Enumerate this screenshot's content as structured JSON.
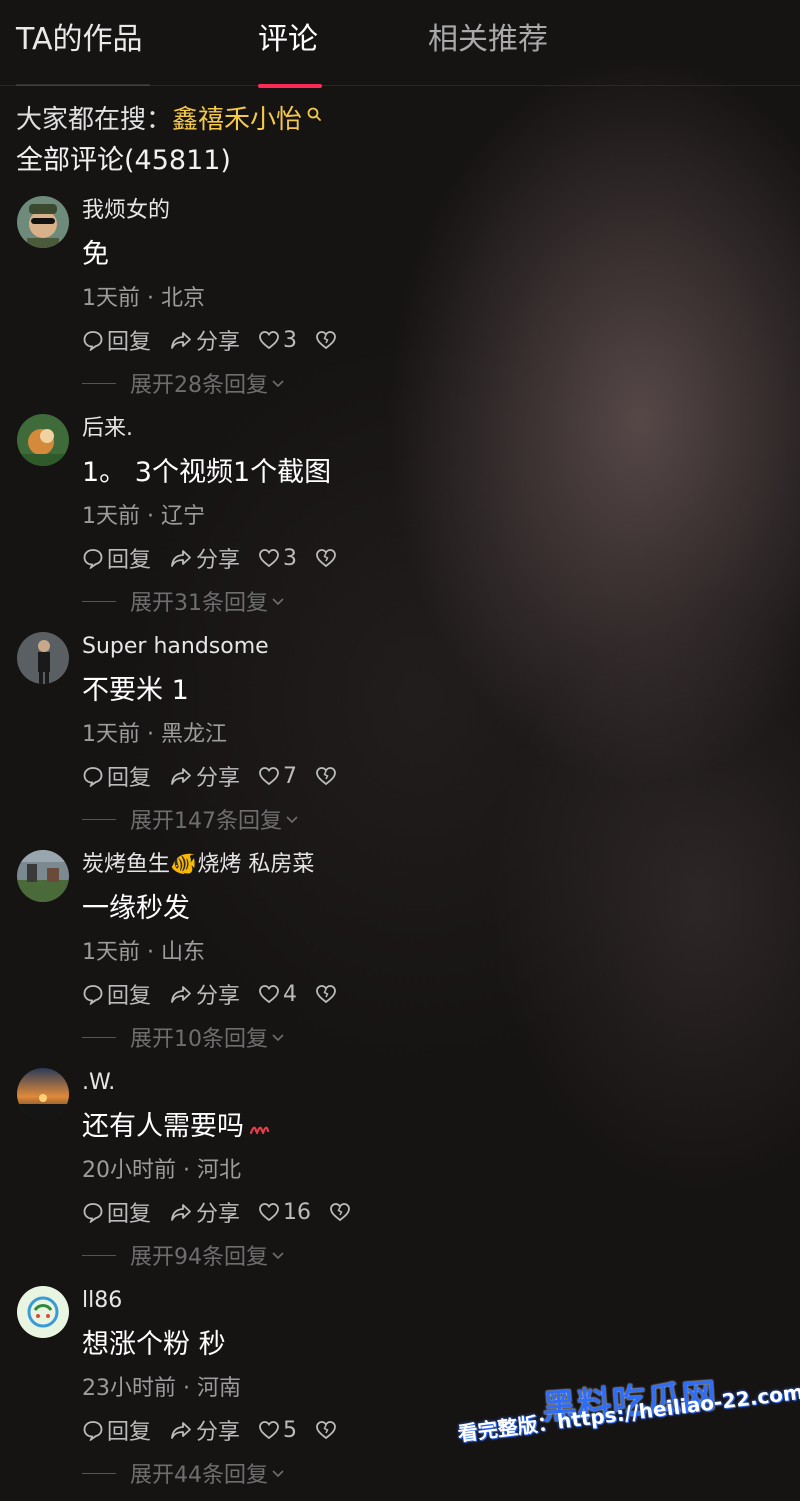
{
  "tabs": [
    {
      "label": "TA的作品"
    },
    {
      "label": "评论"
    },
    {
      "label": "相关推荐"
    }
  ],
  "search_suggest": {
    "prefix": "大家都在搜：",
    "term": "鑫禧禾小怡"
  },
  "comments_header": {
    "title": "全部评论(45811)"
  },
  "actions": {
    "reply": "回复",
    "share": "分享"
  },
  "comments": [
    {
      "user": "我烦女的",
      "text": "免",
      "meta": "1天前 · 北京",
      "likes": "3",
      "expand": "展开28条回复"
    },
    {
      "user": "后来.",
      "text": "1。 3个视频1个截图",
      "meta": "1天前 · 辽宁",
      "likes": "3",
      "expand": "展开31条回复"
    },
    {
      "user": "Super handsome",
      "text": "不要米 1",
      "meta": "1天前 · 黑龙江",
      "likes": "7",
      "expand": "展开147条回复"
    },
    {
      "user": "炭烤鱼生🐠烧烤 私房菜",
      "text": "一缘秒发",
      "meta": "1天前 · 山东",
      "likes": "4",
      "expand": "展开10条回复"
    },
    {
      "user": ".W.",
      "text": "还有人需要吗",
      "meta": "20小时前 · 河北",
      "likes": "16",
      "expand": "展开94条回复"
    },
    {
      "user": "ll86",
      "text": "想涨个粉 秒",
      "meta": "23小时前 · 河南",
      "likes": "5",
      "expand": "展开44条回复"
    }
  ],
  "watermark": {
    "logo": "黑料吃瓜网",
    "url": "看完整版：https://heiliao-22.com"
  },
  "colors": {
    "accent": "#fe2c55",
    "search_term": "#f4c94a",
    "watermark_blue": "#2f6df4"
  }
}
